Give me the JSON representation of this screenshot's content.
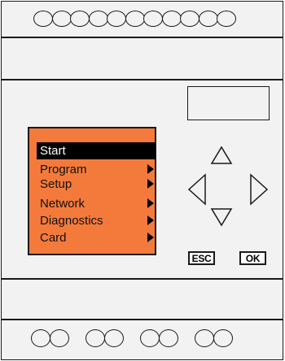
{
  "menu": {
    "items": [
      {
        "label": "Start",
        "selected": true,
        "has_submenu": false
      },
      {
        "label": "Program",
        "selected": false,
        "has_submenu": true
      },
      {
        "label": "Setup",
        "selected": false,
        "has_submenu": true
      },
      {
        "label": "Network",
        "selected": false,
        "has_submenu": true
      },
      {
        "label": "Diagnostics",
        "selected": false,
        "has_submenu": true
      },
      {
        "label": "Card",
        "selected": false,
        "has_submenu": true
      }
    ]
  },
  "buttons": {
    "esc_label": "ESC",
    "ok_label": "OK"
  },
  "colors": {
    "lcd_background": "#f47a3c",
    "housing": "#f2f2f2",
    "outline": "#1a1a1a",
    "selection": "#000000"
  },
  "icons": {
    "up": "arrow-up-icon",
    "down": "arrow-down-icon",
    "left": "arrow-left-icon",
    "right": "arrow-right-icon",
    "submenu": "submenu-arrow-icon"
  }
}
